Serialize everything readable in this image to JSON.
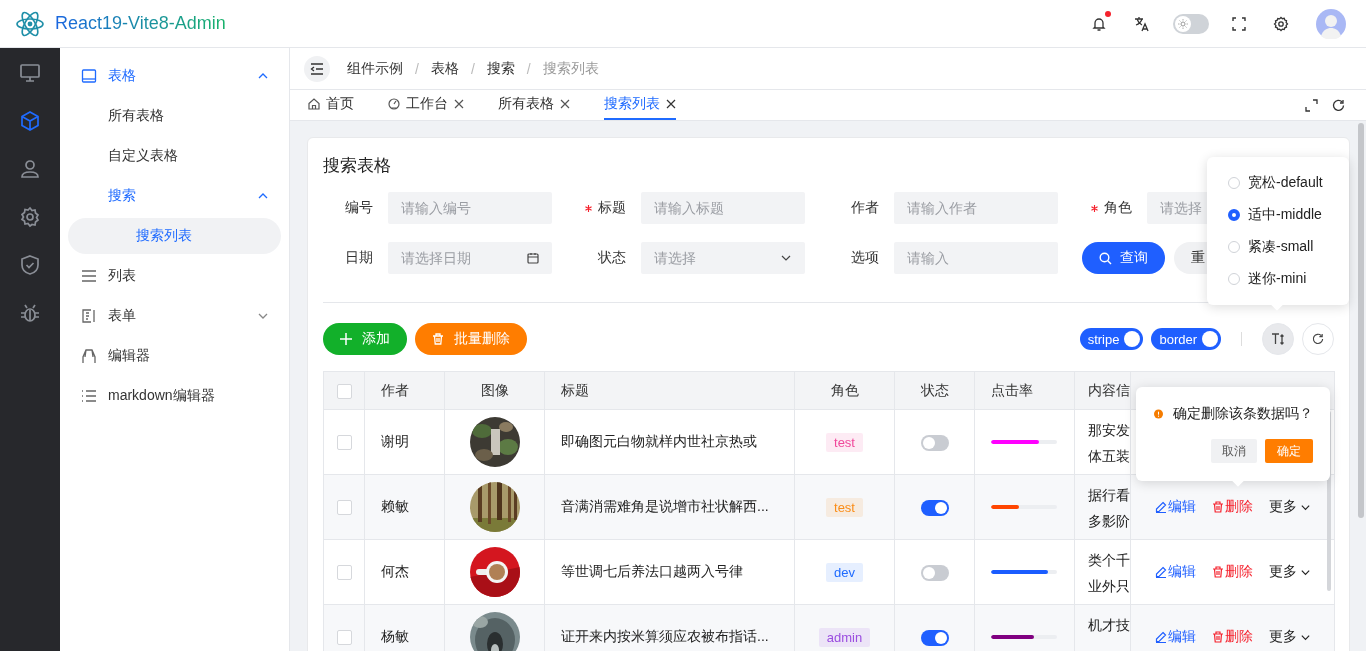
{
  "header": {
    "title": "React19-Vite8-Admin",
    "has_unread": true,
    "dark_mode": false
  },
  "rail": [
    {
      "selected": false
    },
    {
      "selected": true
    },
    {
      "selected": false
    },
    {
      "selected": false
    },
    {
      "selected": false
    },
    {
      "selected": false
    }
  ],
  "menu": [
    {
      "label": "表格",
      "selected": false,
      "expanded": true,
      "children": [
        {
          "label": "所有表格",
          "selected": false
        },
        {
          "label": "自定义表格",
          "selected": false
        },
        {
          "label": "搜索",
          "selected": false,
          "expanded": true,
          "children": [
            {
              "label": "搜索列表",
              "selected": true
            }
          ]
        }
      ]
    },
    {
      "label": "列表",
      "selected": false
    },
    {
      "label": "表单",
      "selected": false,
      "expanded": false
    },
    {
      "label": "编辑器",
      "selected": false
    },
    {
      "label": "markdown编辑器",
      "selected": false
    }
  ],
  "breadcrumb": {
    "items": [
      "组件示例",
      "表格",
      "搜索",
      "搜索列表"
    ],
    "separators": [
      "/",
      "/",
      "/"
    ]
  },
  "tabs": [
    {
      "label": "首页",
      "closable": false,
      "selected": false
    },
    {
      "label": "工作台",
      "closable": true,
      "selected": false
    },
    {
      "label": "所有表格",
      "closable": true,
      "selected": false
    },
    {
      "label": "搜索列表",
      "closable": true,
      "selected": true
    }
  ],
  "card": {
    "title": "搜索表格",
    "fields": [
      {
        "label": "编号",
        "required": false,
        "placeholder": "请输入编号",
        "kind": "text"
      },
      {
        "label": "标题",
        "required": true,
        "placeholder": "请输入标题",
        "kind": "text"
      },
      {
        "label": "作者",
        "required": false,
        "placeholder": "请输入作者",
        "kind": "text"
      },
      {
        "label": "角色",
        "required": true,
        "placeholder": "请选择",
        "kind": "plain"
      },
      {
        "label": "日期",
        "required": false,
        "placeholder": "请选择日期",
        "kind": "date"
      },
      {
        "label": "状态",
        "required": false,
        "placeholder": "请选择",
        "kind": "select"
      },
      {
        "label": "选项",
        "required": false,
        "placeholder": "请输入",
        "kind": "text"
      }
    ],
    "query_button": "查询",
    "reset_button": "重",
    "add_button": "添加",
    "batch_delete_button": "批量删除",
    "stripe": {
      "label": "stripe",
      "on": true
    },
    "border": {
      "label": "border",
      "on": true
    }
  },
  "density_menu": [
    {
      "label": "宽松-default",
      "selected": false
    },
    {
      "label": "适中-middle",
      "selected": true
    },
    {
      "label": "紧凑-small",
      "selected": false
    },
    {
      "label": "迷你-mini",
      "selected": false
    }
  ],
  "table": {
    "all_checked": false,
    "columns": [
      "作者",
      "图像",
      "标题",
      "角色",
      "状态",
      "点击率",
      "内容信"
    ],
    "rows": [
      {
        "checked": false,
        "author": "谢明",
        "title": "即确图元白物就样内世社京热或",
        "role": {
          "label": "test",
          "color": "#f0489b"
        },
        "status_on": false,
        "rate": {
          "level": 0.72,
          "color": "#ff00ff"
        },
        "content": [
          "那安发",
          "体五装"
        ]
      },
      {
        "checked": false,
        "author": "赖敏",
        "title": "音满消需难角是说增市社状解西...",
        "role": {
          "label": "test",
          "color": "#fa8c16"
        },
        "status_on": true,
        "rate": {
          "level": 0.43,
          "color": "#ff4500"
        },
        "content": [
          "据行看",
          "多影阶"
        ],
        "edit": "编辑",
        "delete": "删除",
        "more": "更多"
      },
      {
        "checked": false,
        "author": "何杰",
        "title": "等世调七后养法口越两入号律",
        "role": {
          "label": "dev",
          "color": "#1f6bff"
        },
        "status_on": false,
        "rate": {
          "level": 0.87,
          "color": "#1a5cff"
        },
        "content": [
          "类个千",
          "业外只"
        ],
        "edit": "编辑",
        "delete": "删除",
        "more": "更多"
      },
      {
        "checked": false,
        "author": "杨敏",
        "title": "证开来内按米算须应农被布指话...",
        "role": {
          "label": "admin",
          "color": "#9b4de0"
        },
        "status_on": true,
        "rate": {
          "level": 0.65,
          "color": "#800080"
        },
        "content": [
          "机才技"
        ],
        "edit": "编辑",
        "delete": "删除",
        "more": "更多"
      }
    ]
  },
  "popconfirm": {
    "message": "确定删除该条数据吗？",
    "cancel": "取消",
    "confirm": "确定"
  }
}
